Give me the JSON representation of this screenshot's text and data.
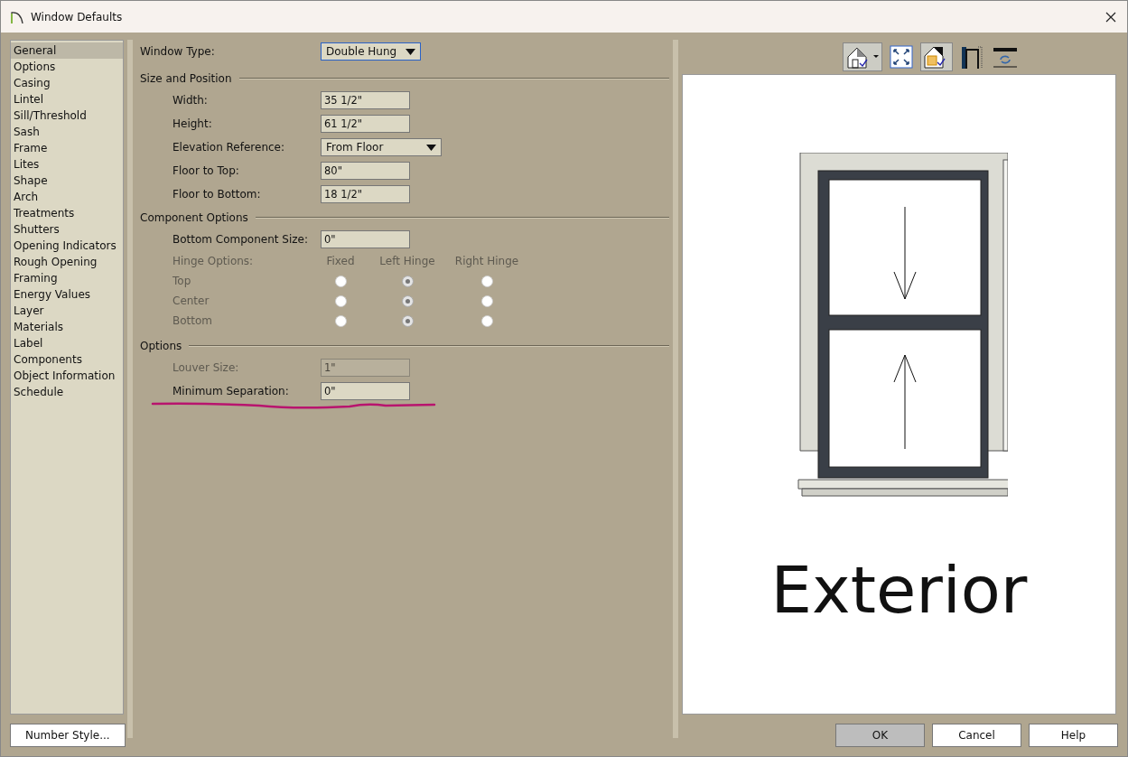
{
  "window": {
    "title": "Window Defaults"
  },
  "sidebar": {
    "items": [
      {
        "label": "General",
        "selected": true
      },
      {
        "label": "Options",
        "selected": false
      },
      {
        "label": "Casing",
        "selected": false
      },
      {
        "label": "Lintel",
        "selected": false
      },
      {
        "label": "Sill/Threshold",
        "selected": false
      },
      {
        "label": "Sash",
        "selected": false
      },
      {
        "label": "Frame",
        "selected": false
      },
      {
        "label": "Lites",
        "selected": false
      },
      {
        "label": "Shape",
        "selected": false
      },
      {
        "label": "Arch",
        "selected": false
      },
      {
        "label": "Treatments",
        "selected": false
      },
      {
        "label": "Shutters",
        "selected": false
      },
      {
        "label": "Opening Indicators",
        "selected": false
      },
      {
        "label": "Rough Opening",
        "selected": false
      },
      {
        "label": "Framing",
        "selected": false
      },
      {
        "label": "Energy Values",
        "selected": false
      },
      {
        "label": "Layer",
        "selected": false
      },
      {
        "label": "Materials",
        "selected": false
      },
      {
        "label": "Label",
        "selected": false
      },
      {
        "label": "Components",
        "selected": false
      },
      {
        "label": "Object Information",
        "selected": false
      },
      {
        "label": "Schedule",
        "selected": false
      }
    ]
  },
  "window_type": {
    "label": "Window Type:",
    "value": "Double Hung"
  },
  "size_and_position": {
    "title": "Size and Position",
    "fields": [
      {
        "kind": "field",
        "label": "Width:",
        "value": "35 1/2\""
      },
      {
        "kind": "field",
        "label": "Height:",
        "value": "61 1/2\""
      },
      {
        "kind": "dropdown",
        "label": "Elevation Reference:",
        "value": "From Floor"
      },
      {
        "kind": "field",
        "label": "Floor to Top:",
        "value": "80\""
      },
      {
        "kind": "field",
        "label": "Floor to Bottom:",
        "value": "18 1/2\""
      }
    ]
  },
  "component_options": {
    "title": "Component Options",
    "fields": [
      {
        "kind": "field",
        "label": "Bottom Component Size:",
        "value": "0\""
      }
    ],
    "hinge_options": {
      "label": "Hinge Options:",
      "disabled": true,
      "columns": [
        "Fixed",
        "Left Hinge",
        "Right Hinge"
      ],
      "rows": [
        {
          "label": "Top",
          "options": [
            {
              "selected": false
            },
            {
              "selected": true
            },
            {
              "selected": false
            }
          ]
        },
        {
          "label": "Center",
          "options": [
            {
              "selected": false
            },
            {
              "selected": true
            },
            {
              "selected": false
            }
          ]
        },
        {
          "label": "Bottom",
          "options": [
            {
              "selected": false
            },
            {
              "selected": true
            },
            {
              "selected": false
            }
          ]
        }
      ]
    }
  },
  "options": {
    "title": "Options",
    "fields": [
      {
        "kind": "field",
        "label": "Louver Size:",
        "value": "1\"",
        "disabled": true
      },
      {
        "kind": "field",
        "label": "Minimum Separation:",
        "value": "0\"",
        "disabled": false
      }
    ]
  },
  "preview": {
    "caption": "Exterior"
  },
  "buttons": {
    "left": "Number Style...",
    "right": [
      {
        "label": "OK",
        "selected": true
      },
      {
        "label": "Cancel",
        "selected": false
      },
      {
        "label": "Help",
        "selected": false
      }
    ]
  }
}
